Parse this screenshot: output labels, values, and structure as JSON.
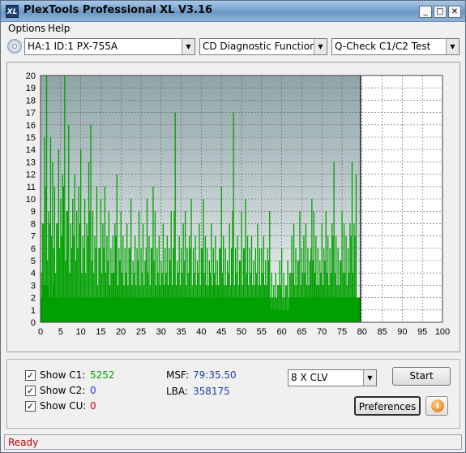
{
  "window": {
    "title": "PlexTools Professional XL V3.16",
    "app_icon_text": "XL",
    "minimize_glyph": "_",
    "maximize_glyph": "□",
    "close_glyph": "✕"
  },
  "menu": {
    "items": [
      "Options",
      "Help"
    ]
  },
  "toolbar": {
    "drive": "HA:1 ID:1  PX-755A",
    "function": "CD Diagnostic Functions",
    "test": "Q-Check C1/C2 Test",
    "dropdown_glyph": "▼"
  },
  "chart_data": {
    "type": "bar",
    "title": "",
    "xlabel": "",
    "ylabel": "",
    "xlim": [
      0,
      100
    ],
    "ylim": [
      0,
      20
    ],
    "x_ticks": [
      0,
      5,
      10,
      15,
      20,
      25,
      30,
      35,
      40,
      45,
      50,
      55,
      60,
      65,
      70,
      75,
      80,
      85,
      90,
      95,
      100
    ],
    "y_ticks": [
      0,
      1,
      2,
      3,
      4,
      5,
      6,
      7,
      8,
      9,
      10,
      11,
      12,
      13,
      14,
      15,
      16,
      17,
      18,
      19,
      20
    ],
    "grid": true,
    "disc_end_minute": 79.6,
    "series": [
      {
        "name": "C1",
        "color": "#00a000",
        "x_minutes": [
          0.5,
          1,
          1.5,
          2,
          2.5,
          3,
          3.5,
          4,
          4.5,
          5,
          5.5,
          6,
          6.5,
          7,
          7.5,
          8,
          8.5,
          9,
          9.5,
          10,
          10.5,
          11,
          11.5,
          12,
          12.5,
          13,
          13.5,
          14,
          14.5,
          15,
          15.5,
          16,
          16.5,
          17,
          17.5,
          18,
          18.5,
          19,
          19.5,
          20,
          20.5,
          21,
          21.5,
          22,
          22.5,
          23,
          23.5,
          24,
          24.5,
          25,
          25.5,
          26,
          26.5,
          27,
          27.5,
          28,
          28.5,
          29,
          29.5,
          30,
          30.5,
          31,
          31.5,
          32,
          32.5,
          33,
          33.5,
          34,
          34.5,
          35,
          35.5,
          36,
          36.5,
          37,
          37.5,
          38,
          38.5,
          39,
          39.5,
          40,
          40.5,
          41,
          41.5,
          42,
          42.5,
          43,
          43.5,
          44,
          44.5,
          45,
          45.5,
          46,
          46.5,
          47,
          47.5,
          48,
          48.5,
          49,
          49.5,
          50,
          50.5,
          51,
          51.5,
          52,
          52.5,
          53,
          53.5,
          54,
          54.5,
          55,
          55.5,
          56,
          56.5,
          57,
          57.5,
          58,
          58.5,
          59,
          59.5,
          60,
          60.5,
          61,
          61.5,
          62,
          62.5,
          63,
          63.5,
          64,
          64.5,
          65,
          65.5,
          66,
          66.5,
          67,
          67.5,
          68,
          68.5,
          69,
          69.5,
          70,
          70.5,
          71,
          71.5,
          72,
          72.5,
          73,
          73.5,
          74,
          74.5,
          75,
          75.5,
          76,
          76.5,
          77,
          77.5,
          78,
          78.5,
          79,
          79.5
        ],
        "peaks": [
          8,
          15,
          20,
          9,
          15,
          13,
          11,
          8,
          14,
          10,
          12,
          20,
          9,
          16,
          8,
          10,
          12,
          9,
          11,
          14,
          7,
          10,
          8,
          13,
          16,
          9,
          7,
          11,
          6,
          10,
          8,
          11,
          7,
          9,
          6,
          7,
          8,
          12,
          6,
          9,
          7,
          6,
          8,
          6,
          10,
          5,
          7,
          6,
          9,
          6,
          8,
          5,
          10,
          7,
          6,
          11,
          9,
          6,
          7,
          5,
          8,
          6,
          7,
          6,
          9,
          6,
          17,
          5,
          7,
          6,
          8,
          9,
          6,
          7,
          10,
          6,
          7,
          5,
          8,
          6,
          10,
          7,
          6,
          5,
          8,
          6,
          7,
          5,
          6,
          11,
          7,
          6,
          5,
          8,
          6,
          17,
          6,
          7,
          5,
          9,
          6,
          10,
          7,
          6,
          7,
          5,
          6,
          8,
          6,
          6,
          7,
          5,
          6,
          9,
          4,
          3,
          4,
          3,
          5,
          6,
          4,
          3,
          5,
          4,
          7,
          8,
          6,
          5,
          9,
          6,
          7,
          8,
          6,
          5,
          10,
          9,
          7,
          6,
          5,
          8,
          6,
          9,
          7,
          6,
          8,
          13,
          7,
          6,
          5,
          9,
          8,
          7,
          6,
          8,
          13,
          8,
          12
        ],
        "baseline": [
          2,
          3,
          3,
          3,
          2,
          2,
          3,
          2,
          2,
          2,
          2,
          2,
          2,
          2,
          2,
          2,
          2,
          2,
          2,
          2,
          2,
          2,
          2,
          2,
          2,
          2,
          2,
          2,
          2,
          2,
          2,
          2,
          2,
          2,
          2,
          2,
          2,
          2,
          2,
          2,
          2,
          2,
          2,
          2,
          2,
          2,
          2,
          2,
          2,
          2,
          2,
          2,
          2,
          2,
          2,
          2,
          2,
          2,
          2,
          2,
          2,
          2,
          2,
          2,
          2,
          2,
          2,
          2,
          2,
          2,
          2,
          2,
          2,
          2,
          2,
          2,
          2,
          2,
          2,
          2,
          2,
          2,
          2,
          2,
          2,
          2,
          2,
          2,
          2,
          2,
          2,
          2,
          2,
          2,
          2,
          2,
          2,
          2,
          2,
          2,
          2,
          2,
          2,
          2,
          2,
          2,
          2,
          2,
          2,
          2,
          2,
          2,
          2,
          2,
          1,
          1,
          1,
          1,
          1,
          1,
          1,
          1,
          1,
          1,
          2,
          2,
          2,
          2,
          2,
          2,
          2,
          2,
          2,
          2,
          2,
          2,
          2,
          2,
          2,
          2,
          2,
          2,
          2,
          2,
          2,
          2,
          2,
          2,
          2,
          2,
          2,
          2,
          2,
          2,
          2,
          2,
          2,
          2,
          2
        ]
      }
    ]
  },
  "stats": {
    "c1_label": "Show C1:",
    "c1_value": "5252",
    "c1_color": "#00a000",
    "c2_label": "Show C2:",
    "c2_value": "0",
    "c2_color": "#1f3fbf",
    "cu_label": "Show CU:",
    "cu_value": "0",
    "cu_color": "#d00000",
    "check_glyph": "✓",
    "msf_label": "MSF:",
    "msf_value": "79:35.50",
    "lba_label": "LBA:",
    "lba_value": "358175",
    "value_color": "#1f3f9f"
  },
  "controls": {
    "speed": "8 X CLV",
    "start_label": "Start",
    "preferences_label": "Preferences",
    "info_glyph": "i"
  },
  "status": {
    "text": "Ready"
  }
}
